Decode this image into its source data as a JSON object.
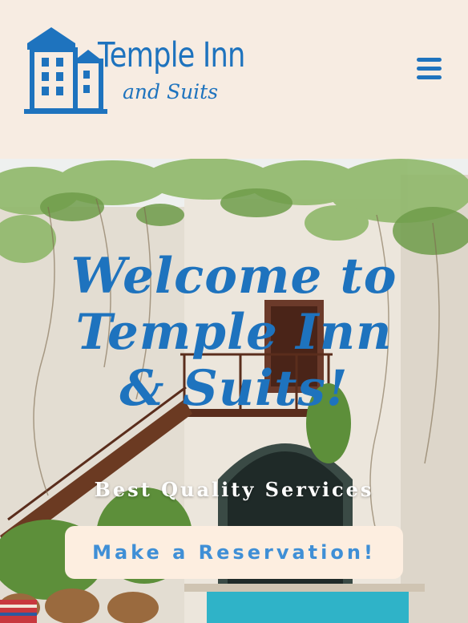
{
  "header": {
    "logo": {
      "title": "Temple Inn",
      "subtitle": "and Suits",
      "icon": "building-icon"
    },
    "menu_icon": "hamburger-menu-icon"
  },
  "hero": {
    "title": "Welcome to Temple Inn & Suits!",
    "subtitle": "Best Quality Services",
    "cta_label": "Make a Reservation!",
    "background": "courtyard-photo"
  },
  "colors": {
    "brand": "#1e73be",
    "header_bg": "#f7ece2",
    "cta_bg": "#fdeee0",
    "cta_text": "#3f8fd6"
  }
}
